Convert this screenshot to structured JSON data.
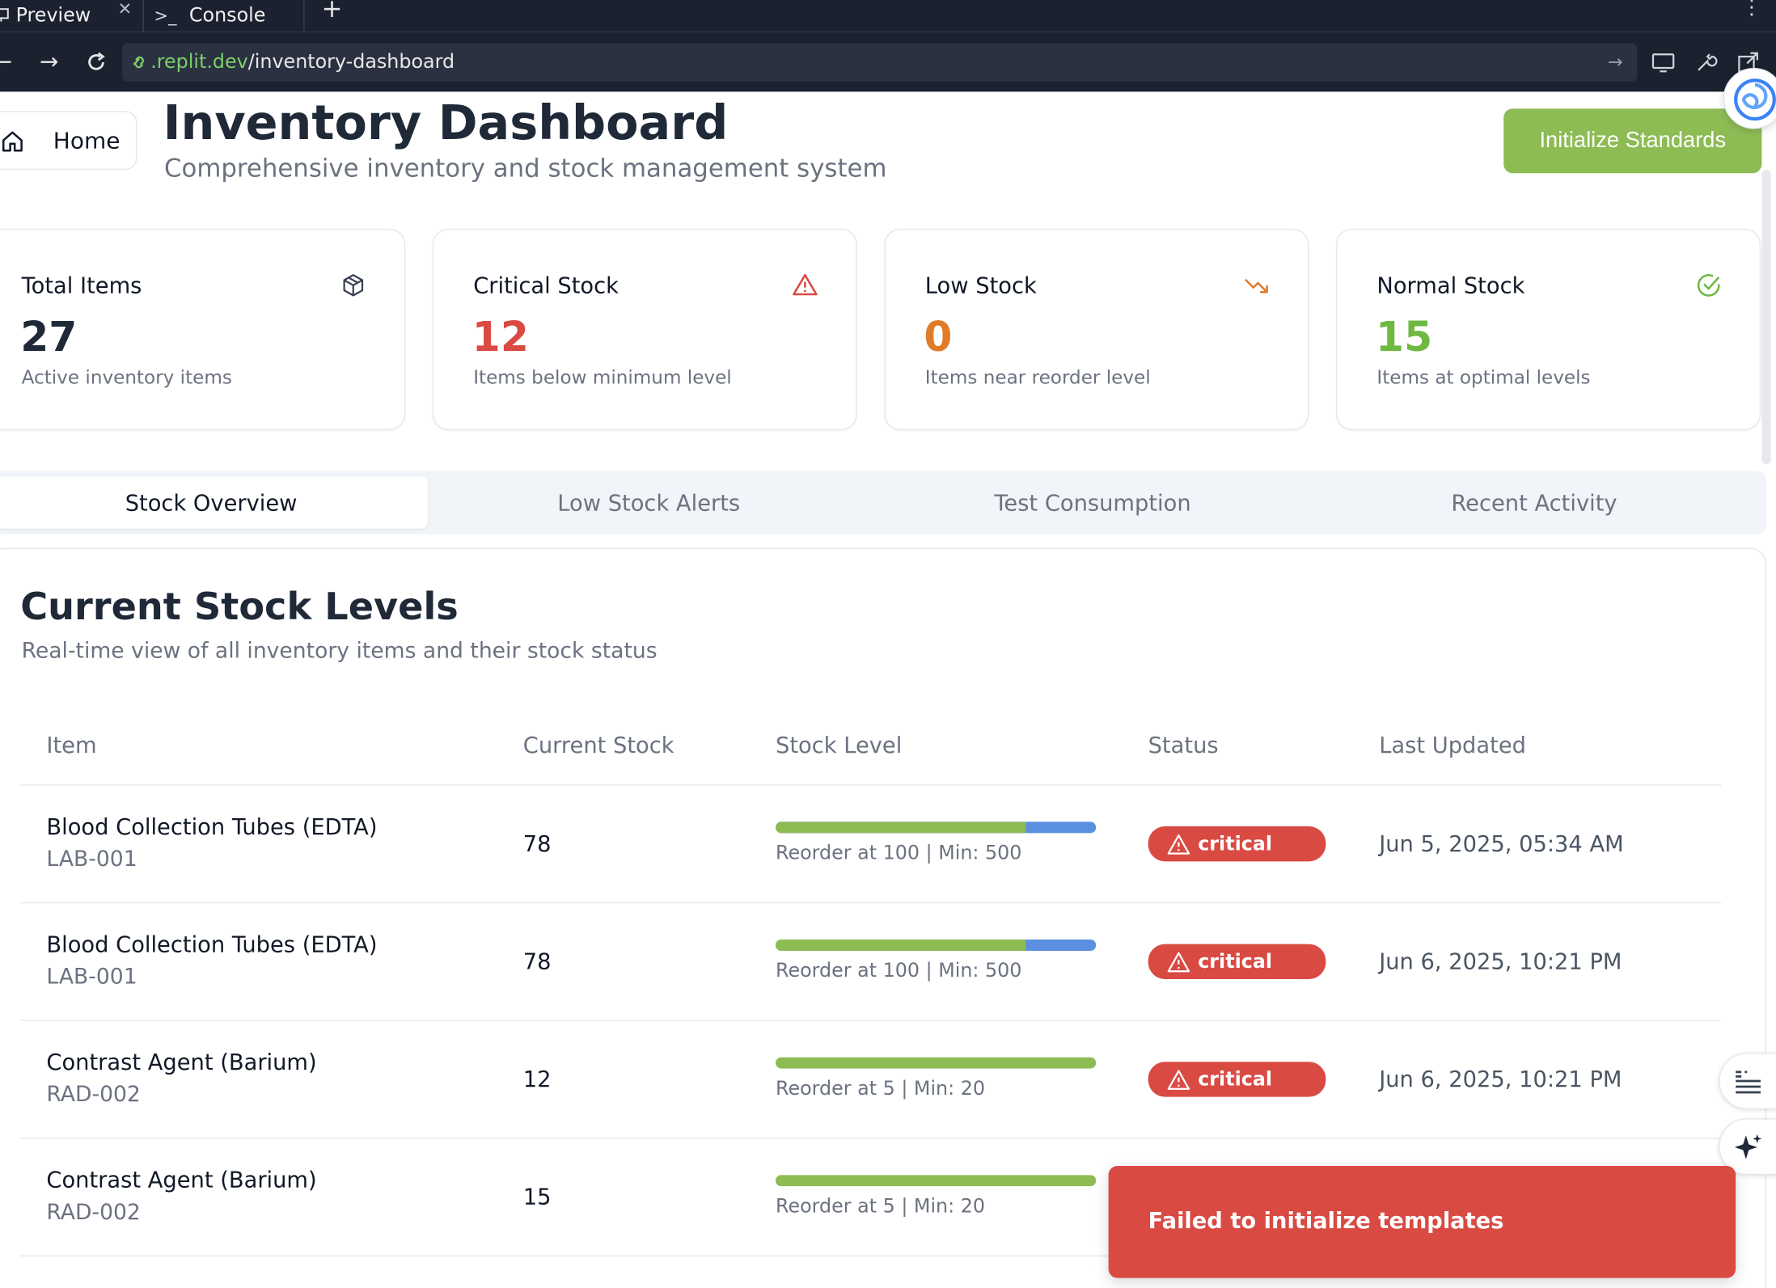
{
  "browser": {
    "tabs": [
      {
        "label": "Preview",
        "icon": "monitor-icon"
      },
      {
        "label": "Console",
        "icon": "terminal-icon"
      }
    ],
    "url_host": ".replit.dev",
    "url_path": "/inventory-dashboard"
  },
  "header": {
    "home_label": "Home",
    "title": "Inventory Dashboard",
    "subtitle": "Comprehensive inventory and stock management system",
    "init_button": "Initialize Standards"
  },
  "cards": [
    {
      "title": "Total Items",
      "value": "27",
      "desc": "Active inventory items",
      "icon": "package-icon",
      "color": "#1f2937"
    },
    {
      "title": "Critical Stock",
      "value": "12",
      "desc": "Items below minimum level",
      "icon": "warning-triangle-icon",
      "color": "#d94a43"
    },
    {
      "title": "Low Stock",
      "value": "0",
      "desc": "Items near reorder level",
      "icon": "trending-down-icon",
      "color": "#e07b2a"
    },
    {
      "title": "Normal Stock",
      "value": "15",
      "desc": "Items at optimal levels",
      "icon": "check-circle-icon",
      "color": "#6fb842"
    }
  ],
  "tabs": [
    "Stock Overview",
    "Low Stock Alerts",
    "Test Consumption",
    "Recent Activity"
  ],
  "active_tab": "Stock Overview",
  "panel": {
    "title": "Current Stock Levels",
    "subtitle": "Real-time view of all inventory items and their stock status",
    "columns": [
      "Item",
      "Current Stock",
      "Stock Level",
      "Status",
      "Last Updated"
    ],
    "rows": [
      {
        "name": "Blood Collection Tubes (EDTA)",
        "code": "LAB-001",
        "stock": "78",
        "level": 0.78,
        "note": "Reorder at 100 | Min: 500",
        "status": "critical",
        "updated": "Jun 5, 2025, 05:34 AM"
      },
      {
        "name": "Blood Collection Tubes (EDTA)",
        "code": "LAB-001",
        "stock": "78",
        "level": 0.78,
        "note": "Reorder at 100 | Min: 500",
        "status": "critical",
        "updated": "Jun 6, 2025, 10:21 PM"
      },
      {
        "name": "Contrast Agent (Barium)",
        "code": "RAD-002",
        "stock": "12",
        "level": 1.0,
        "note": "Reorder at 5 | Min: 20",
        "status": "critical",
        "updated": "Jun 6, 2025, 10:21 PM"
      },
      {
        "name": "Contrast Agent (Barium)",
        "code": "RAD-002",
        "stock": "15",
        "level": 1.0,
        "note": "Reorder at 5 | Min: 20",
        "status": "",
        "updated": ""
      }
    ]
  },
  "toast": {
    "message": "Failed to initialize templates"
  },
  "colors": {
    "accent_green": "#8dbb54",
    "critical_red": "#d94a43",
    "bar_blue": "#5b8fe0"
  }
}
